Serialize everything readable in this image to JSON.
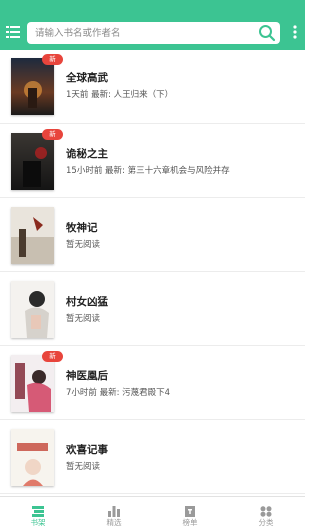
{
  "search": {
    "placeholder": "请输入书名或作者名"
  },
  "books": [
    {
      "title": "全球高武",
      "subtitle": "1天前 最新: 人王归来（下）",
      "is_new": true
    },
    {
      "title": "诡秘之主",
      "subtitle": "15小时前 最新: 第三十六章机会与风险并存",
      "is_new": true
    },
    {
      "title": "牧神记",
      "subtitle": "暂无阅读",
      "is_new": false
    },
    {
      "title": "村女凶猛",
      "subtitle": "暂无阅读",
      "is_new": false
    },
    {
      "title": "神医凰后",
      "subtitle": "7小时前 最新: 污蔑君殿下4",
      "is_new": true
    },
    {
      "title": "欢喜记事",
      "subtitle": "暂无阅读",
      "is_new": false
    }
  ],
  "badge_label": "新",
  "covers": [
    {
      "text": "全球高武"
    },
    {
      "text": "诡秘之主"
    },
    {
      "text": "牧神记"
    },
    {
      "text": "村女凶猛"
    },
    {
      "text": "神医凰后"
    },
    {
      "text": "欢喜记事"
    }
  ],
  "nav": {
    "items": [
      {
        "label": "书架",
        "icon": "bookshelf-icon",
        "active": true
      },
      {
        "label": "精选",
        "icon": "chart-icon",
        "active": false
      },
      {
        "label": "榜单",
        "icon": "ranking-icon",
        "active": false
      },
      {
        "label": "分类",
        "icon": "category-icon",
        "active": false
      }
    ]
  },
  "colors": {
    "accent": "#3cc492",
    "badge": "#e8453c",
    "nav_inactive": "#9a9a9a"
  }
}
